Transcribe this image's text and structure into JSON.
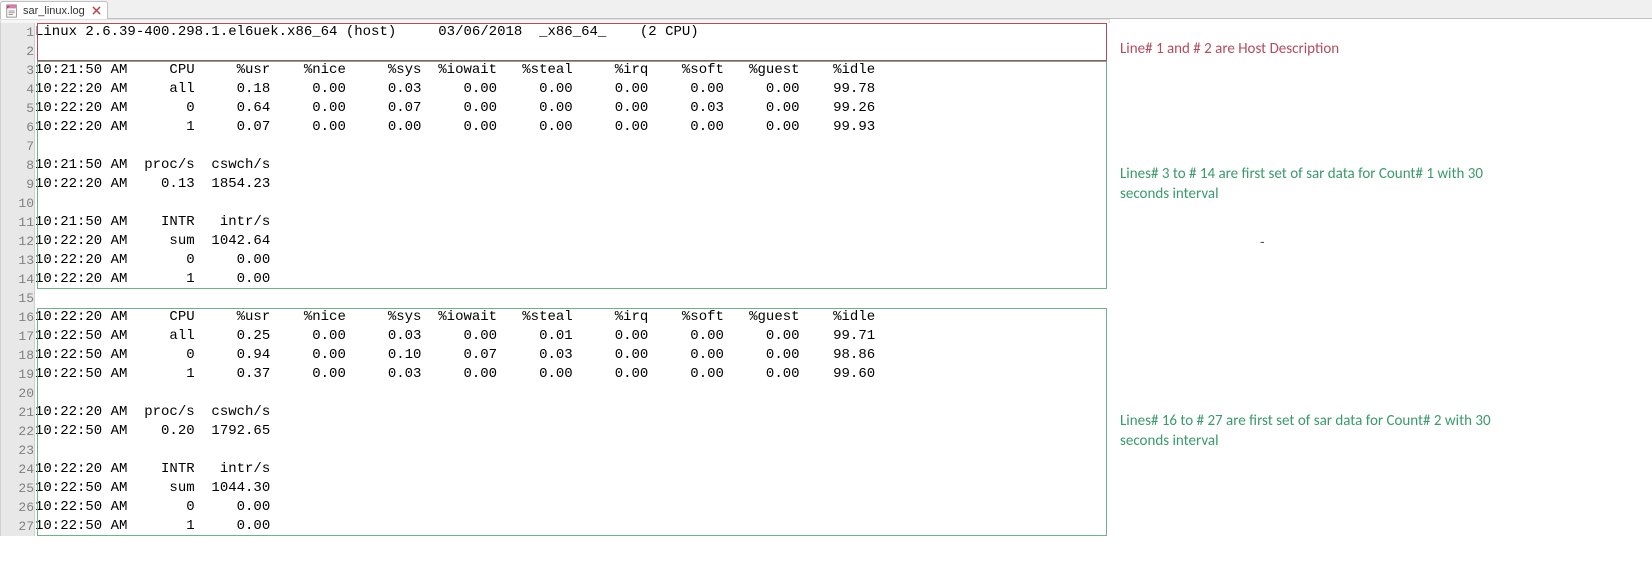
{
  "tab": {
    "filename": "sar_linux.log"
  },
  "lines": [
    "Linux 2.6.39-400.298.1.el6uek.x86_64 (host)     03/06/2018  _x86_64_    (2 CPU)",
    "",
    "10:21:50 AM     CPU     %usr    %nice     %sys  %iowait   %steal     %irq    %soft   %guest    %idle",
    "10:22:20 AM     all     0.18     0.00     0.03     0.00     0.00     0.00     0.00     0.00    99.78",
    "10:22:20 AM       0     0.64     0.00     0.07     0.00     0.00     0.00     0.03     0.00    99.26",
    "10:22:20 AM       1     0.07     0.00     0.00     0.00     0.00     0.00     0.00     0.00    99.93",
    "",
    "10:21:50 AM  proc/s  cswch/s",
    "10:22:20 AM    0.13  1854.23",
    "",
    "10:21:50 AM    INTR   intr/s",
    "10:22:20 AM     sum  1042.64",
    "10:22:20 AM       0     0.00",
    "10:22:20 AM       1     0.00",
    "",
    "10:22:20 AM     CPU     %usr    %nice     %sys  %iowait   %steal     %irq    %soft   %guest    %idle",
    "10:22:50 AM     all     0.25     0.00     0.03     0.00     0.01     0.00     0.00     0.00    99.71",
    "10:22:50 AM       0     0.94     0.00     0.10     0.07     0.03     0.00     0.00     0.00    98.86",
    "10:22:50 AM       1     0.37     0.00     0.03     0.00     0.00     0.00     0.00     0.00    99.60",
    "",
    "10:22:20 AM  proc/s  cswch/s",
    "10:22:50 AM    0.20  1792.65",
    "",
    "10:22:20 AM    INTR   intr/s",
    "10:22:50 AM     sum  1044.30",
    "10:22:50 AM       0     0.00",
    "10:22:50 AM       1     0.00"
  ],
  "annotations": {
    "a1": "Line# 1 and # 2 are Host Description",
    "a2": "Lines# 3 to # 14 are first set of sar data for Count# 1 with 30 seconds interval",
    "a3": "Lines# 16 to # 27 are first set of sar data for Count# 2 with 30 seconds interval",
    "dash": "-"
  },
  "boxes": {
    "red": {
      "topRow": 1,
      "bottomRow": 2
    },
    "green1": {
      "topRow": 3,
      "bottomRow": 14
    },
    "green2": {
      "topRow": 16,
      "bottomRow": 27
    }
  }
}
